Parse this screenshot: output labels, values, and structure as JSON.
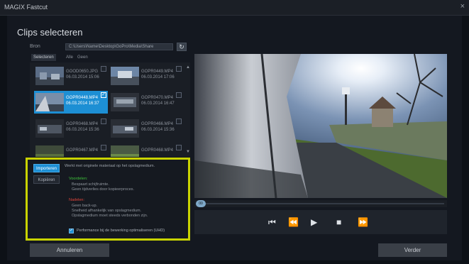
{
  "window": {
    "title": "MAGIX Fastcut",
    "close_glyph": "×"
  },
  "heading": "Clips selecteren",
  "source": {
    "label": "Bron",
    "path": "C:\\Users\\Name\\Desktop\\GoPro\\Media\\Share",
    "refresh_icon": "refresh-icon"
  },
  "filter_tabs": [
    "Selecteren",
    "Alle",
    "Geen"
  ],
  "clips": [
    {
      "name": "GOOD0650.JPG",
      "date": "06.03.2014 15:06",
      "selected": false,
      "checked": false
    },
    {
      "name": "GOPR0449.MP4",
      "date": "06.03.2014 17:06",
      "selected": false,
      "checked": false
    },
    {
      "name": "GOPR0448.MP4",
      "date": "06.03.2014 16:37",
      "selected": true,
      "checked": true
    },
    {
      "name": "GOPR0470.MP4",
      "date": "06.03.2014 16:47",
      "selected": false,
      "checked": false
    },
    {
      "name": "GOPR0468.MP4",
      "date": "06.03.2014 15:36",
      "selected": false,
      "checked": false
    },
    {
      "name": "GOPR0466.MP4",
      "date": "06.03.2014 15:36",
      "selected": false,
      "checked": false
    },
    {
      "name": "GOPR0467.MP4",
      "date": "",
      "selected": false,
      "checked": false
    },
    {
      "name": "GOPR0468.MP4",
      "date": "",
      "selected": false,
      "checked": false
    }
  ],
  "options": {
    "import_label": "Importeren",
    "copy_label": "Kopiëren",
    "description": "Werkt met originele materiaal op het opslagmedium.",
    "advantages_title": "Voordelen:",
    "advantages": [
      "Bespaart schijfruimte.",
      "Geen tijdverlies door kopieerproces."
    ],
    "disadvantages_title": "Nadelen:",
    "disadvantages": [
      "Geen back-up.",
      "Snelheid afhankelijk van opslagmedium.",
      "Opslagmedium moet steeds verbonden zijn."
    ],
    "performance_label": "Performance bij de bewerking optimaliseren (UHD)",
    "performance_checked": true
  },
  "timeline": {
    "position_label": "00"
  },
  "transport": {
    "skip_start": "⏮",
    "rewind": "⏪",
    "play": "▶",
    "stop": "■",
    "fast_forward": "⏩"
  },
  "buttons": {
    "cancel": "Annuleren",
    "next": "Verder"
  },
  "colors": {
    "accent": "#1d8fd4",
    "highlight_frame": "#c9d300",
    "advantage": "#3ec43b",
    "disadvantage": "#e0443a"
  }
}
